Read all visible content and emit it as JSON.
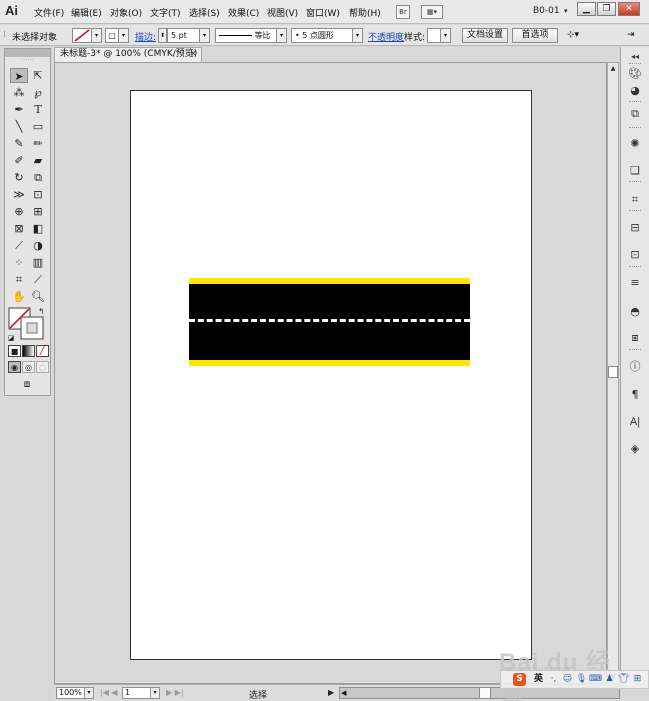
{
  "app": {
    "logo": "Ai"
  },
  "menu": {
    "items": [
      "文件(F)",
      "编辑(E)",
      "对象(O)",
      "文字(T)",
      "选择(S)",
      "效果(C)",
      "视图(V)",
      "窗口(W)",
      "帮助(H)"
    ],
    "bridge_label": "Br",
    "workspace": "B0-01",
    "window_buttons": {
      "minimize": "▁",
      "restore": "❐",
      "close": "✕"
    }
  },
  "control": {
    "selection": "未选择对象",
    "stroke_label": "描边:",
    "stroke_weight": "5 pt",
    "profile": "等比",
    "brush": "5 点圆形",
    "opacity_label": "不透明度",
    "style_label": "样式:",
    "doc_setup": "文档设置",
    "preferences": "首选项"
  },
  "document": {
    "tab_title": "未标题-3* @ 100% (CMYK/预览)",
    "tab_close": "×"
  },
  "colors": {
    "road": "#000000",
    "road_edge": "#ffe600",
    "road_dash": "#ffffff",
    "accent": "#1a46b8"
  },
  "status": {
    "zoom": "100%",
    "artboard_num": "1",
    "tool": "选择"
  },
  "watermark": {
    "text": "Bai du 经验",
    "site": "jingyan.baidu.com"
  },
  "tray": {
    "lang": "英"
  },
  "icons": {
    "tools": [
      "selection-tool-icon",
      "direct-selection-tool-icon",
      "magic-wand-tool-icon",
      "lasso-tool-icon",
      "pen-tool-icon",
      "type-tool-icon",
      "line-tool-icon",
      "rectangle-tool-icon",
      "paintbrush-tool-icon",
      "pencil-tool-icon",
      "blob-brush-tool-icon",
      "eraser-tool-icon",
      "rotate-tool-icon",
      "scale-tool-icon",
      "width-tool-icon",
      "free-transform-tool-icon",
      "shape-builder-tool-icon",
      "perspective-grid-tool-icon",
      "mesh-tool-icon",
      "gradient-tool-icon",
      "eyedropper-tool-icon",
      "blend-tool-icon",
      "symbol-sprayer-tool-icon",
      "column-graph-tool-icon",
      "artboard-tool-icon",
      "slice-tool-icon",
      "hand-tool-icon",
      "zoom-tool-icon"
    ],
    "dock": [
      "color-panel-icon",
      "color-guide-icon",
      "swatches-icon",
      "brushes-icon",
      "symbols-icon",
      "graphic-styles-icon",
      "transform-icon",
      "align-icon",
      "pathfinder-icon",
      "stroke-icon",
      "gradient-panel-icon",
      "transparency-icon",
      "appearance-icon",
      "layers-icon"
    ]
  }
}
